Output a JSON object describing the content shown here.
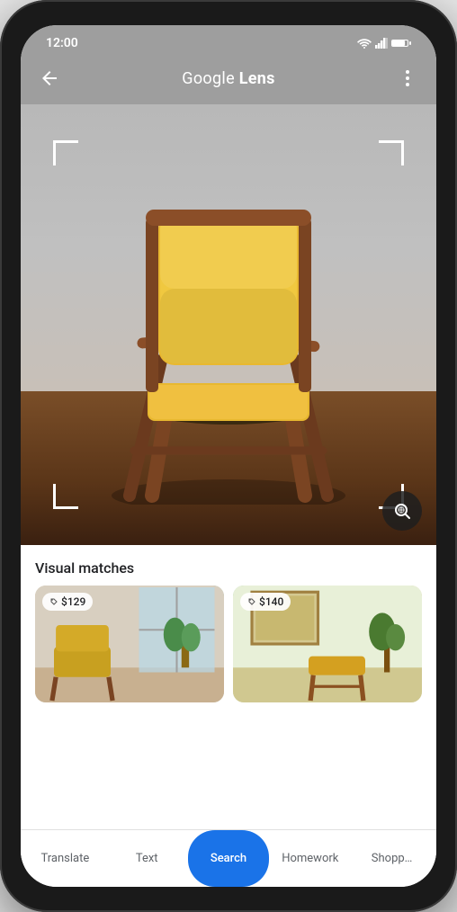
{
  "status_bar": {
    "time": "12:00",
    "signal_icon": "signal",
    "wifi_icon": "wifi",
    "battery_icon": "battery"
  },
  "top_bar": {
    "title": "Google Lens",
    "title_bold": "Lens",
    "back_label": "back",
    "more_label": "more options"
  },
  "image": {
    "alt": "Yellow mid-century modern chair with wooden frame"
  },
  "content": {
    "visual_matches_label": "Visual matches",
    "matches": [
      {
        "price": "$129",
        "alt": "Similar yellow chair in room"
      },
      {
        "price": "$140",
        "alt": "Similar yellow chair with wood elements"
      }
    ]
  },
  "tab_bar": {
    "tabs": [
      {
        "id": "translate",
        "label": "Translate",
        "active": false
      },
      {
        "id": "text",
        "label": "Text",
        "active": false
      },
      {
        "id": "search",
        "label": "Search",
        "active": true
      },
      {
        "id": "homework",
        "label": "Homework",
        "active": false
      },
      {
        "id": "shopping",
        "label": "Shopp…",
        "active": false
      }
    ]
  },
  "icons": {
    "tag": "🏷",
    "lens_search": "🔍"
  }
}
